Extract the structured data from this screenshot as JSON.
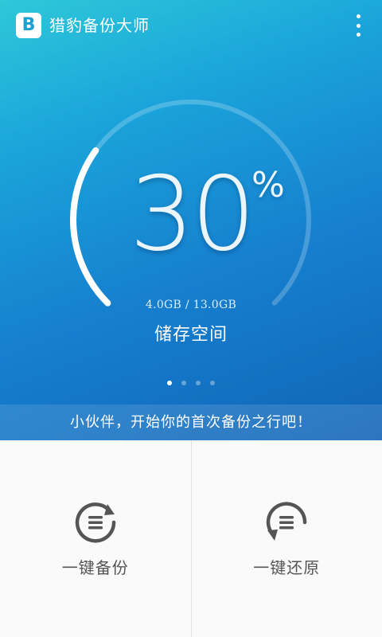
{
  "app": {
    "title": "猎豹备份大师",
    "logo_letter": "B"
  },
  "storage": {
    "percent_value": "30",
    "percent_sign": "%",
    "percent": 30,
    "usage": "4.0GB / 13.0GB",
    "label": "储存空间"
  },
  "pager": {
    "count": 4,
    "active_index": 0
  },
  "banner": {
    "text": "小伙伴，开始你的首次备份之行吧！"
  },
  "actions": {
    "backup_label": "一键备份",
    "restore_label": "一键还原"
  },
  "colors": {
    "hero_top": "#2ec8d9",
    "hero_bottom": "#1164b7",
    "icon_gray": "#555555",
    "text_gray": "#555555"
  },
  "icons": {
    "menu": "more-vertical-icon",
    "backup": "sync-list-icon",
    "restore": "restore-list-icon"
  }
}
